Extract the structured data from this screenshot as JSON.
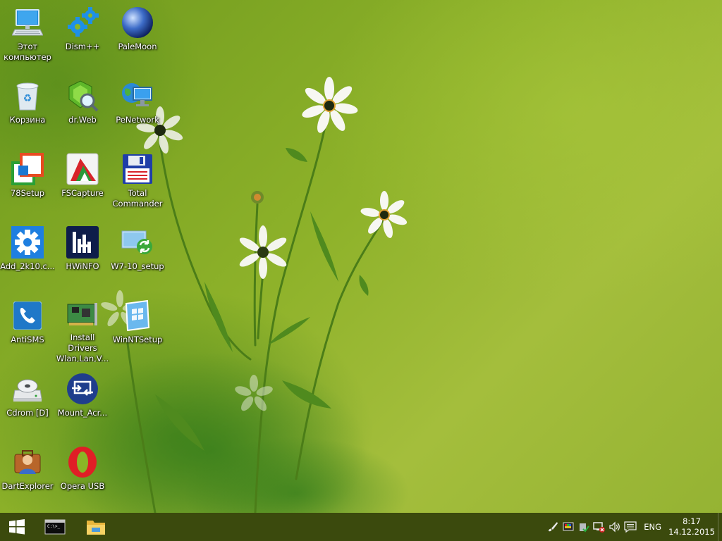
{
  "desktop_icons": [
    {
      "label": "Этот\nкомпьютер",
      "icon": "this-pc-icon"
    },
    {
      "label": "Dism++",
      "icon": "gears-icon"
    },
    {
      "label": "PaleMoon",
      "icon": "moon-globe-icon"
    },
    {
      "label": "Корзина",
      "icon": "recycle-bin-icon"
    },
    {
      "label": "dr.Web",
      "icon": "drweb-spider-icon"
    },
    {
      "label": "PeNetwork",
      "icon": "network-globe-icon"
    },
    {
      "label": "78Setup",
      "icon": "setup-windows-icon"
    },
    {
      "label": "FSCapture",
      "icon": "capture-icon"
    },
    {
      "label": "Total\nCommander",
      "icon": "floppy-disk-icon"
    },
    {
      "label": "Add_2k10.c...",
      "icon": "settings-gear-icon"
    },
    {
      "label": "HWiNFO",
      "icon": "hwinfo-icon"
    },
    {
      "label": "W7-10_setup",
      "icon": "setup-arrows-icon"
    },
    {
      "label": "AntiSMS",
      "icon": "phone-icon"
    },
    {
      "label": "Install Drivers\nWlan,Lan,V...",
      "icon": "circuit-board-icon"
    },
    {
      "label": "WinNTSetup",
      "icon": "windows-setup-icon"
    },
    {
      "label": "Cdrom [D]",
      "icon": "cd-drive-icon"
    },
    {
      "label": "Mount_Acr...",
      "icon": "mount-icon"
    },
    {
      "label": "DartExplorer",
      "icon": "briefcase-user-icon"
    },
    {
      "label": "Opera USB",
      "icon": "opera-icon"
    }
  ],
  "taskbar": {
    "pinned": [
      {
        "name": "start-button",
        "icon": "windows-logo-icon"
      },
      {
        "name": "command-prompt-button",
        "icon": "cmd-icon"
      },
      {
        "name": "file-explorer-button",
        "icon": "folder-icon"
      }
    ],
    "tray_icons": [
      "brush-icon",
      "color-display-icon",
      "shield-check-icon",
      "network-error-icon",
      "speaker-icon",
      "notification-icon"
    ],
    "language": "ENG",
    "time": "8:17",
    "date": "14.12.2015"
  },
  "colors": {
    "taskbar": "#3b4a0d",
    "wallpaper_green": "#8eb22a"
  }
}
